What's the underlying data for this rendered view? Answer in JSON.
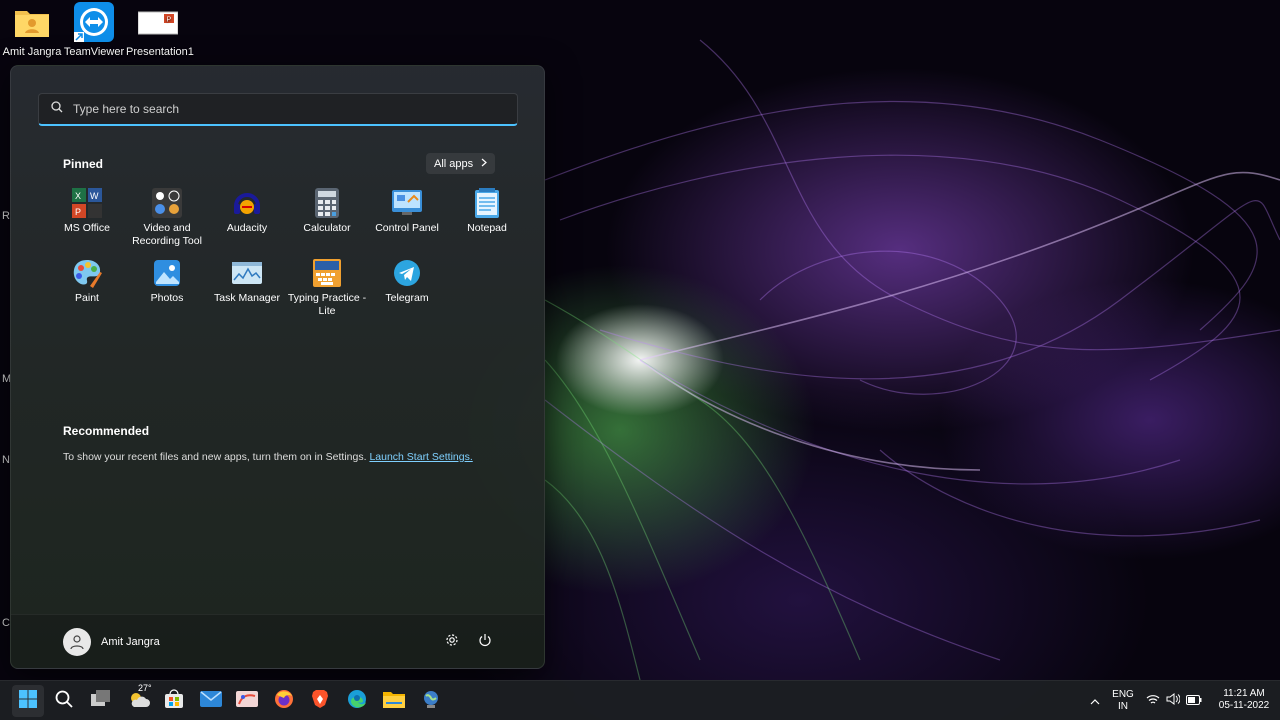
{
  "desktop": {
    "icons": [
      {
        "label": "Amit Jangra",
        "icon": "user-folder-icon"
      },
      {
        "label": "TeamViewer",
        "icon": "teamviewer-icon"
      },
      {
        "label": "Presentation1",
        "icon": "powerpoint-file-icon"
      }
    ],
    "edge_letters": [
      "R",
      "M",
      "N",
      "C"
    ]
  },
  "start_menu": {
    "search_placeholder": "Type here to search",
    "pinned_title": "Pinned",
    "all_apps_label": "All apps",
    "pinned_apps": [
      {
        "label": "MS Office",
        "icon": "ms-office-icon"
      },
      {
        "label": "Video and Recording Tool",
        "icon": "video-recording-icon"
      },
      {
        "label": "Audacity",
        "icon": "audacity-icon"
      },
      {
        "label": "Calculator",
        "icon": "calculator-icon"
      },
      {
        "label": "Control Panel",
        "icon": "control-panel-icon"
      },
      {
        "label": "Notepad",
        "icon": "notepad-icon"
      },
      {
        "label": "Paint",
        "icon": "paint-icon"
      },
      {
        "label": "Photos",
        "icon": "photos-icon"
      },
      {
        "label": "Task Manager",
        "icon": "task-manager-icon"
      },
      {
        "label": "Typing Practice - Lite",
        "icon": "typing-practice-icon"
      },
      {
        "label": "Telegram",
        "icon": "telegram-icon"
      }
    ],
    "recommended_title": "Recommended",
    "recommended_text": "To show your recent files and new apps, turn them on in Settings.",
    "recommended_link": "Launch Start Settings.",
    "user_name": "Amit Jangra"
  },
  "taskbar": {
    "weather_temp": "27°",
    "icons": [
      "start-icon",
      "search-icon",
      "task-view-icon",
      "weather-icon",
      "store-icon",
      "mail-icon",
      "paint-app-icon",
      "firefox-icon",
      "brave-icon",
      "edge-icon",
      "file-explorer-icon",
      "globe-app-icon"
    ],
    "tray": {
      "lang_top": "ENG",
      "lang_bottom": "IN",
      "time": "11:21 AM",
      "date": "05-11-2022"
    }
  },
  "colors": {
    "accent": "#4cc2ff",
    "link": "#7fd0ff"
  }
}
